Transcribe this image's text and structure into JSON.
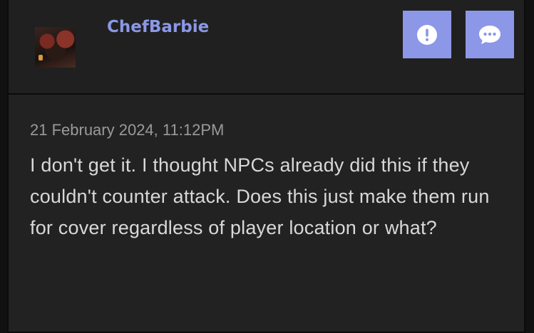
{
  "post": {
    "username": "ChefBarbie",
    "timestamp": "21 February 2024, 11:12PM",
    "message": "I don't get it. I thought NPCs already did this if they couldn't counter attack. Does this just make them run for cover regardless of player location or what?"
  },
  "actions": {
    "report_icon": "exclamation-circle-icon",
    "reply_icon": "chat-bubble-icon"
  },
  "colors": {
    "accent": "#8d97e8",
    "username": "#8b98e6",
    "card_bg": "#222222"
  }
}
